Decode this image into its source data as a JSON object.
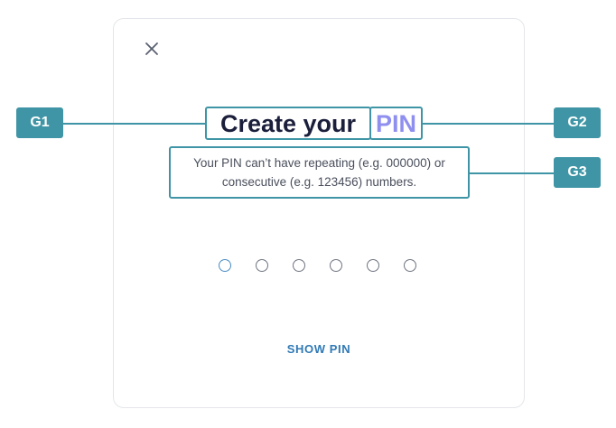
{
  "dialog": {
    "close_icon": "close-icon",
    "title_main": "Create your",
    "title_highlight": "PIN",
    "subtitle": "Your PIN can’t have repeating (e.g. 000000) or consecutive (e.g. 123456) numbers.",
    "pin_length": 6,
    "pin_filled": 0,
    "show_pin_label": "SHOW PIN"
  },
  "annotations": {
    "g1": "G1",
    "g2": "G2",
    "g3": "G3"
  },
  "colors": {
    "accent": "#3f95a5",
    "title": "#1b1f3b",
    "highlight": "#8f8ff0",
    "link": "#2f79b5"
  }
}
